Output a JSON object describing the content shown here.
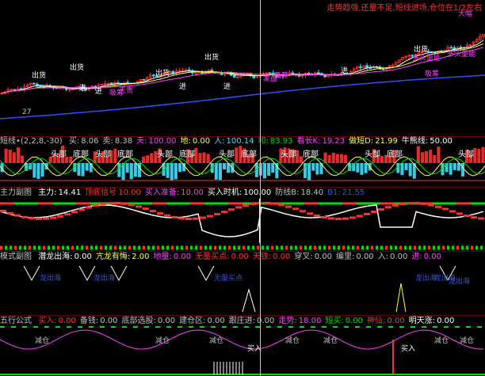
{
  "colors": {
    "red": "#ff3030",
    "green": "#00e000",
    "cyan": "#40e0ff",
    "white": "#ffffff",
    "yellow": "#ffff40",
    "magenta": "#ff40ff",
    "blue": "#3050ff",
    "grey": "#c0c0c0"
  },
  "main": {
    "notice": "走势趋强,还量不足,短线进场,仓位在1/2左右",
    "labels": [
      "出货",
      "出货",
      "出货",
      "出货",
      "出货",
      "进",
      "进",
      "进",
      "进",
      "大幅",
      "多头量能",
      "多头量能",
      "发盘",
      "进",
      "天贵",
      "吸筹",
      "吸筹",
      "吸筹"
    ],
    "price_left": "27"
  },
  "kdj": {
    "name": "短线•(2,2,8,-30)",
    "items": [
      {
        "label": "买:",
        "value": "8.06",
        "color": "#c0c0c0"
      },
      {
        "label": "卖:",
        "value": "8.38",
        "color": "#c0c0c0"
      },
      {
        "label": "天:",
        "value": "100.00",
        "color": "#ff40ff"
      },
      {
        "label": "地:",
        "value": "0.00",
        "color": "#ffff40"
      },
      {
        "label": "人:",
        "value": "100.14",
        "color": "#40e0ff"
      },
      {
        "label": "和:",
        "value": "83.93",
        "color": "#00e000"
      },
      {
        "label": "看长K:",
        "value": "19.23",
        "color": "#ff40ff"
      },
      {
        "label": "做短D:",
        "value": "21.99",
        "color": "#ffff40"
      },
      {
        "label": "牛熊线:",
        "value": "50.00",
        "color": "#ffffff"
      }
    ],
    "tags": [
      "头部",
      "底部",
      "头部",
      "底部",
      "头部",
      "底部",
      "头部",
      "底部",
      "头部",
      "底部",
      "头部",
      "底部",
      "头部"
    ]
  },
  "main_force": {
    "name": "主力副图",
    "items": [
      {
        "label": "主力:",
        "value": "14.41",
        "color": "#ffffff"
      },
      {
        "label": "顶底信号",
        "value": "10.00",
        "color": "#ff3030"
      },
      {
        "label": "买入准备:",
        "value": "10.00",
        "color": "#ff40ff"
      },
      {
        "label": "买入时机:",
        "value": "100.00",
        "color": "#ffffff"
      },
      {
        "label": "防线B:",
        "value": "18.40",
        "color": "#c0c0c0"
      },
      {
        "label": "B1:",
        "value": "21.55",
        "color": "#3050ff"
      }
    ]
  },
  "dive": {
    "name": "模式副图",
    "items": [
      {
        "label": "潜龙出海:",
        "value": "0.00",
        "color": "#ffffff"
      },
      {
        "label": "亢龙有悔:",
        "value": "2.00",
        "color": "#ffff40"
      },
      {
        "label": "地量:",
        "value": "0.00",
        "color": "#ff40ff"
      },
      {
        "label": "无量买点:",
        "value": "0.00",
        "color": "#ff3030"
      },
      {
        "label": "天铁:",
        "value": "0.00",
        "color": "#ff3030"
      },
      {
        "label": "穿叉:",
        "value": "0.00",
        "color": "#c0c0c0"
      },
      {
        "label": "编里:",
        "value": "0.00",
        "color": "#c0c0c0"
      },
      {
        "label": "入:",
        "value": "0.00",
        "color": "#c0c0c0"
      },
      {
        "label": "进:",
        "value": "0.00",
        "color": "#ff40ff"
      }
    ],
    "markers": [
      "龙出海",
      "龙出海",
      "无量买点",
      "龙出海",
      "龙出海",
      "龙出海"
    ]
  },
  "formula": {
    "name": "五行公式",
    "items": [
      {
        "label": "买入:",
        "value": "0.00",
        "color": "#ff3030"
      },
      {
        "label": "备钱:",
        "value": "0.00",
        "color": "#c0c0c0"
      },
      {
        "label": "底部选股:",
        "value": "0.00",
        "color": "#c0c0c0"
      },
      {
        "label": "建仓区:",
        "value": "0.00",
        "color": "#c0c0c0"
      },
      {
        "label": "跟庄进:",
        "value": "0.00",
        "color": "#c0c0c0"
      },
      {
        "label": "走势:",
        "value": "18.00",
        "color": "#ff40ff"
      },
      {
        "label": "短买:",
        "value": "0.00",
        "color": "#00e000"
      },
      {
        "label": "神仙:",
        "value": "0.00",
        "color": "#ff3030"
      },
      {
        "label": "明天涨:",
        "value": "0.00",
        "color": "#ffffff"
      }
    ],
    "tags": [
      "减仓",
      "减仓",
      "减仓",
      "减仓",
      "减仓",
      "减仓",
      "买入",
      "减仓",
      "买入"
    ]
  }
}
